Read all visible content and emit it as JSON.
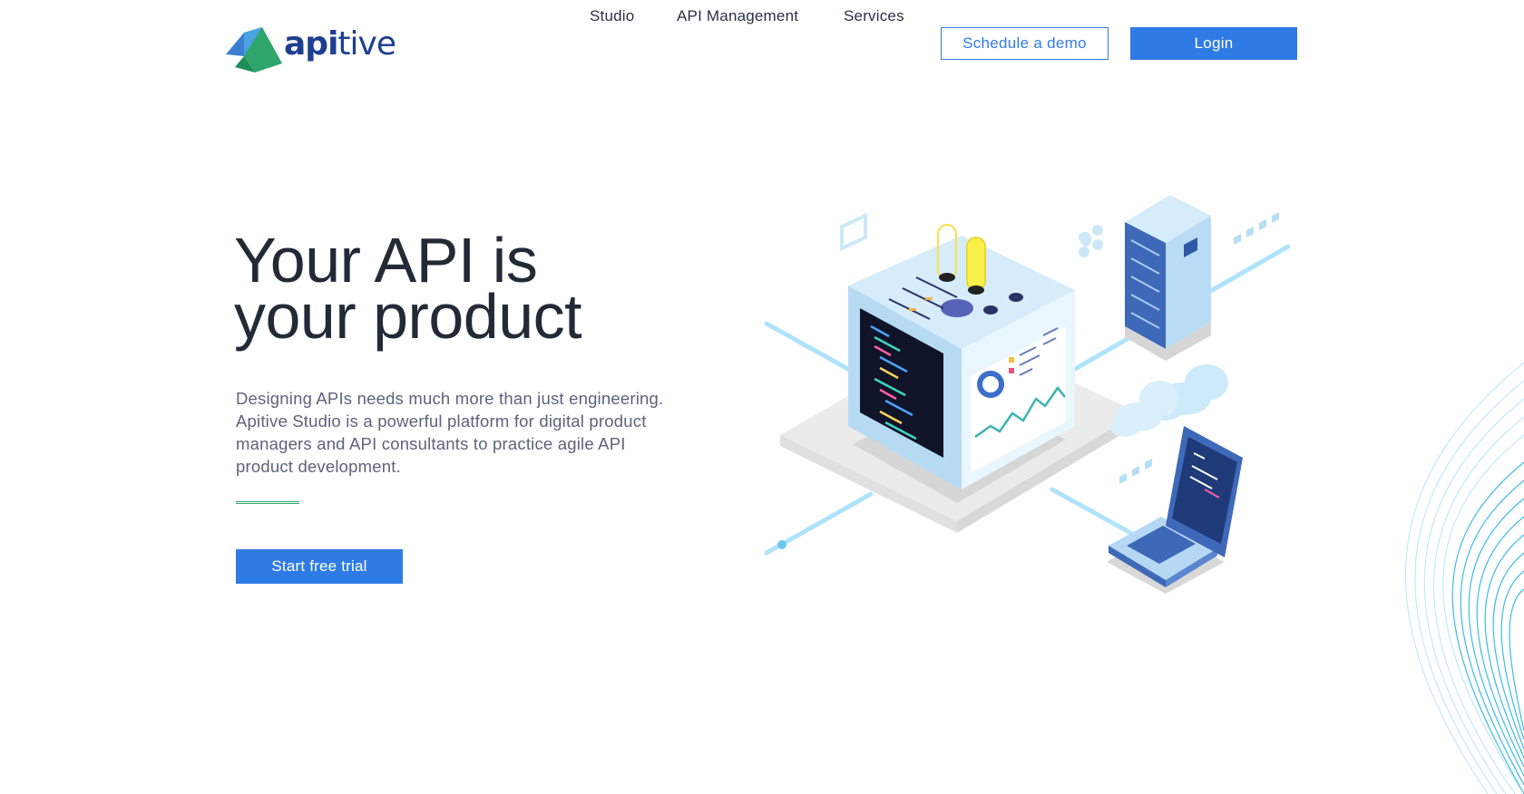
{
  "brand": {
    "logo_text_bold": "api",
    "logo_text_light": "tive",
    "colors": {
      "primary": "#2f7be5",
      "navy": "#1e3f8f",
      "green": "#2ea56a",
      "text": "#222a36"
    }
  },
  "nav": {
    "items": [
      {
        "label": "Studio"
      },
      {
        "label": "API Management"
      },
      {
        "label": "Services"
      }
    ],
    "demo_label": "Schedule a demo",
    "login_label": "Login"
  },
  "hero": {
    "title_line1": "Your API is",
    "title_line2": "your product",
    "description": "Designing APIs needs much more than just engineering. Apitive Studio is a powerful platform for digital product managers and API consultants to practice agile API product development.",
    "cta_label": "Start free trial"
  },
  "icons": {
    "logo": "apitive-logo-icon",
    "illustration": "isometric-api-studio-illustration",
    "server": "server-rack-icon",
    "laptop": "laptop-icon",
    "cloud": "cloud-icon"
  }
}
